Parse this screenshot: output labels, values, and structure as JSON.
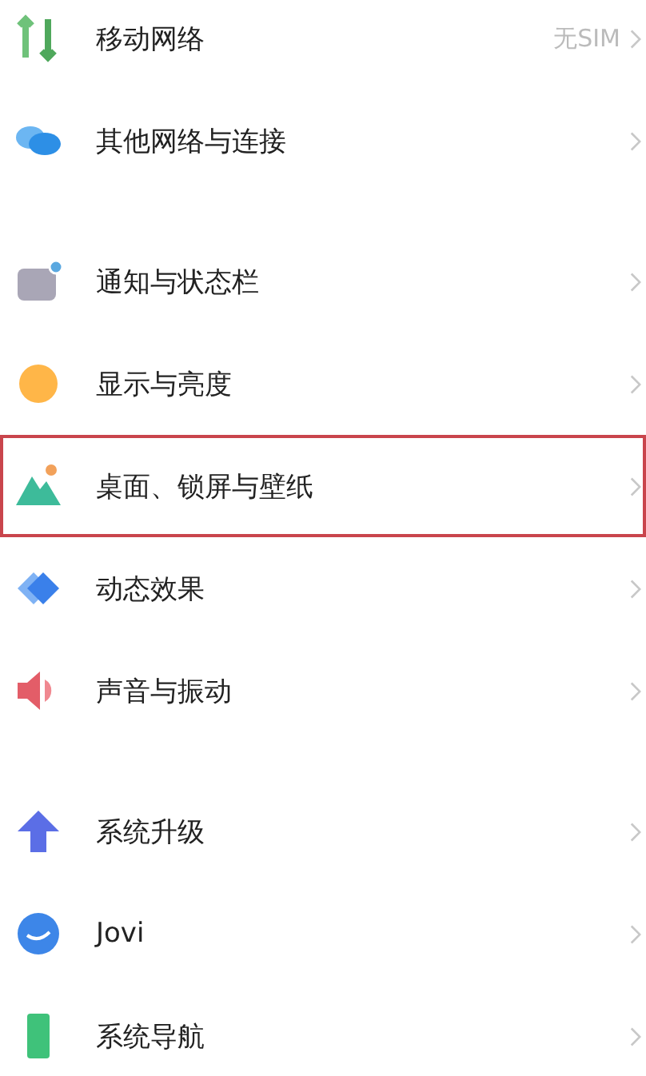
{
  "groups": [
    {
      "items": [
        {
          "label": "移动网络",
          "value": "无SIM",
          "highlighted": false
        },
        {
          "label": "其他网络与连接",
          "highlighted": false
        }
      ]
    },
    {
      "items": [
        {
          "label": "通知与状态栏",
          "highlighted": false
        },
        {
          "label": "显示与亮度",
          "highlighted": false
        },
        {
          "label": "桌面、锁屏与壁纸",
          "highlighted": true
        },
        {
          "label": "动态效果",
          "highlighted": false
        },
        {
          "label": "声音与振动",
          "highlighted": false
        }
      ]
    },
    {
      "items": [
        {
          "label": "系统升级",
          "highlighted": false
        },
        {
          "label": "Jovi",
          "highlighted": false
        },
        {
          "label": "系统导航",
          "highlighted": false
        }
      ]
    }
  ]
}
